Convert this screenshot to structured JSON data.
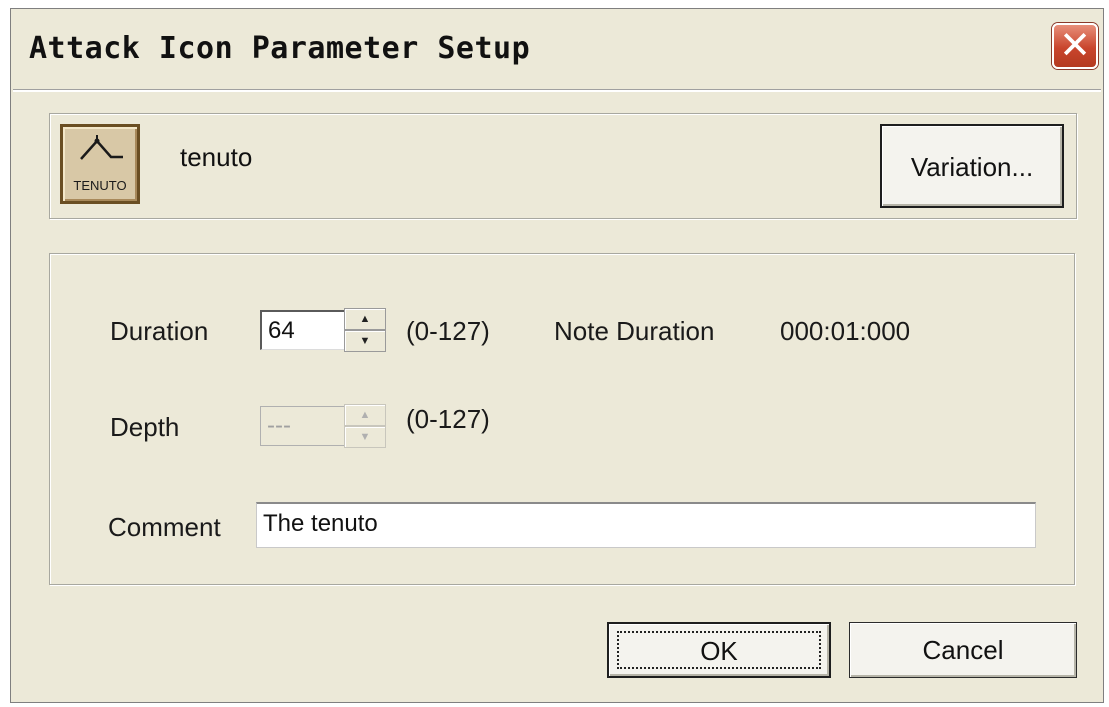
{
  "window": {
    "title": "Attack Icon Parameter Setup",
    "close_glyph": "✕"
  },
  "icon": {
    "caption": "TENUTO",
    "name": "tenuto",
    "icon_name": "tenuto-icon"
  },
  "variation_button": {
    "label": "Variation..."
  },
  "duration": {
    "label": "Duration",
    "value": "64",
    "range": "(0-127)",
    "note_label": "Note Duration",
    "note_value": "000:01:000"
  },
  "depth": {
    "label": "Depth",
    "value": "---",
    "range": "(0-127)"
  },
  "comment": {
    "label": "Comment",
    "value": "The tenuto"
  },
  "buttons": {
    "ok": "OK",
    "cancel": "Cancel"
  },
  "colors": {
    "dialog_bg": "#ece9d8",
    "close_button": "#c9452d"
  }
}
